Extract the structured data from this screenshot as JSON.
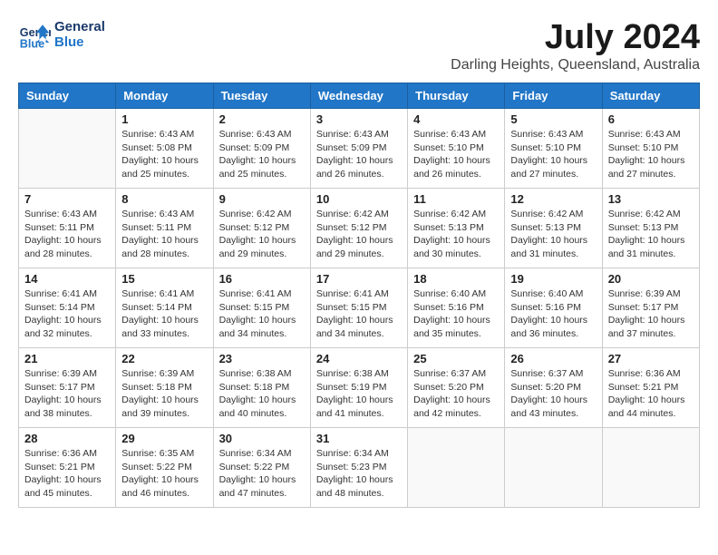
{
  "logo": {
    "line1": "General",
    "line2": "Blue"
  },
  "title": "July 2024",
  "location": "Darling Heights, Queensland, Australia",
  "headers": [
    "Sunday",
    "Monday",
    "Tuesday",
    "Wednesday",
    "Thursday",
    "Friday",
    "Saturday"
  ],
  "weeks": [
    [
      {
        "day": "",
        "info": ""
      },
      {
        "day": "1",
        "info": "Sunrise: 6:43 AM\nSunset: 5:08 PM\nDaylight: 10 hours\nand 25 minutes."
      },
      {
        "day": "2",
        "info": "Sunrise: 6:43 AM\nSunset: 5:09 PM\nDaylight: 10 hours\nand 25 minutes."
      },
      {
        "day": "3",
        "info": "Sunrise: 6:43 AM\nSunset: 5:09 PM\nDaylight: 10 hours\nand 26 minutes."
      },
      {
        "day": "4",
        "info": "Sunrise: 6:43 AM\nSunset: 5:10 PM\nDaylight: 10 hours\nand 26 minutes."
      },
      {
        "day": "5",
        "info": "Sunrise: 6:43 AM\nSunset: 5:10 PM\nDaylight: 10 hours\nand 27 minutes."
      },
      {
        "day": "6",
        "info": "Sunrise: 6:43 AM\nSunset: 5:10 PM\nDaylight: 10 hours\nand 27 minutes."
      }
    ],
    [
      {
        "day": "7",
        "info": "Sunrise: 6:43 AM\nSunset: 5:11 PM\nDaylight: 10 hours\nand 28 minutes."
      },
      {
        "day": "8",
        "info": "Sunrise: 6:43 AM\nSunset: 5:11 PM\nDaylight: 10 hours\nand 28 minutes."
      },
      {
        "day": "9",
        "info": "Sunrise: 6:42 AM\nSunset: 5:12 PM\nDaylight: 10 hours\nand 29 minutes."
      },
      {
        "day": "10",
        "info": "Sunrise: 6:42 AM\nSunset: 5:12 PM\nDaylight: 10 hours\nand 29 minutes."
      },
      {
        "day": "11",
        "info": "Sunrise: 6:42 AM\nSunset: 5:13 PM\nDaylight: 10 hours\nand 30 minutes."
      },
      {
        "day": "12",
        "info": "Sunrise: 6:42 AM\nSunset: 5:13 PM\nDaylight: 10 hours\nand 31 minutes."
      },
      {
        "day": "13",
        "info": "Sunrise: 6:42 AM\nSunset: 5:13 PM\nDaylight: 10 hours\nand 31 minutes."
      }
    ],
    [
      {
        "day": "14",
        "info": "Sunrise: 6:41 AM\nSunset: 5:14 PM\nDaylight: 10 hours\nand 32 minutes."
      },
      {
        "day": "15",
        "info": "Sunrise: 6:41 AM\nSunset: 5:14 PM\nDaylight: 10 hours\nand 33 minutes."
      },
      {
        "day": "16",
        "info": "Sunrise: 6:41 AM\nSunset: 5:15 PM\nDaylight: 10 hours\nand 34 minutes."
      },
      {
        "day": "17",
        "info": "Sunrise: 6:41 AM\nSunset: 5:15 PM\nDaylight: 10 hours\nand 34 minutes."
      },
      {
        "day": "18",
        "info": "Sunrise: 6:40 AM\nSunset: 5:16 PM\nDaylight: 10 hours\nand 35 minutes."
      },
      {
        "day": "19",
        "info": "Sunrise: 6:40 AM\nSunset: 5:16 PM\nDaylight: 10 hours\nand 36 minutes."
      },
      {
        "day": "20",
        "info": "Sunrise: 6:39 AM\nSunset: 5:17 PM\nDaylight: 10 hours\nand 37 minutes."
      }
    ],
    [
      {
        "day": "21",
        "info": "Sunrise: 6:39 AM\nSunset: 5:17 PM\nDaylight: 10 hours\nand 38 minutes."
      },
      {
        "day": "22",
        "info": "Sunrise: 6:39 AM\nSunset: 5:18 PM\nDaylight: 10 hours\nand 39 minutes."
      },
      {
        "day": "23",
        "info": "Sunrise: 6:38 AM\nSunset: 5:18 PM\nDaylight: 10 hours\nand 40 minutes."
      },
      {
        "day": "24",
        "info": "Sunrise: 6:38 AM\nSunset: 5:19 PM\nDaylight: 10 hours\nand 41 minutes."
      },
      {
        "day": "25",
        "info": "Sunrise: 6:37 AM\nSunset: 5:20 PM\nDaylight: 10 hours\nand 42 minutes."
      },
      {
        "day": "26",
        "info": "Sunrise: 6:37 AM\nSunset: 5:20 PM\nDaylight: 10 hours\nand 43 minutes."
      },
      {
        "day": "27",
        "info": "Sunrise: 6:36 AM\nSunset: 5:21 PM\nDaylight: 10 hours\nand 44 minutes."
      }
    ],
    [
      {
        "day": "28",
        "info": "Sunrise: 6:36 AM\nSunset: 5:21 PM\nDaylight: 10 hours\nand 45 minutes."
      },
      {
        "day": "29",
        "info": "Sunrise: 6:35 AM\nSunset: 5:22 PM\nDaylight: 10 hours\nand 46 minutes."
      },
      {
        "day": "30",
        "info": "Sunrise: 6:34 AM\nSunset: 5:22 PM\nDaylight: 10 hours\nand 47 minutes."
      },
      {
        "day": "31",
        "info": "Sunrise: 6:34 AM\nSunset: 5:23 PM\nDaylight: 10 hours\nand 48 minutes."
      },
      {
        "day": "",
        "info": ""
      },
      {
        "day": "",
        "info": ""
      },
      {
        "day": "",
        "info": ""
      }
    ]
  ]
}
